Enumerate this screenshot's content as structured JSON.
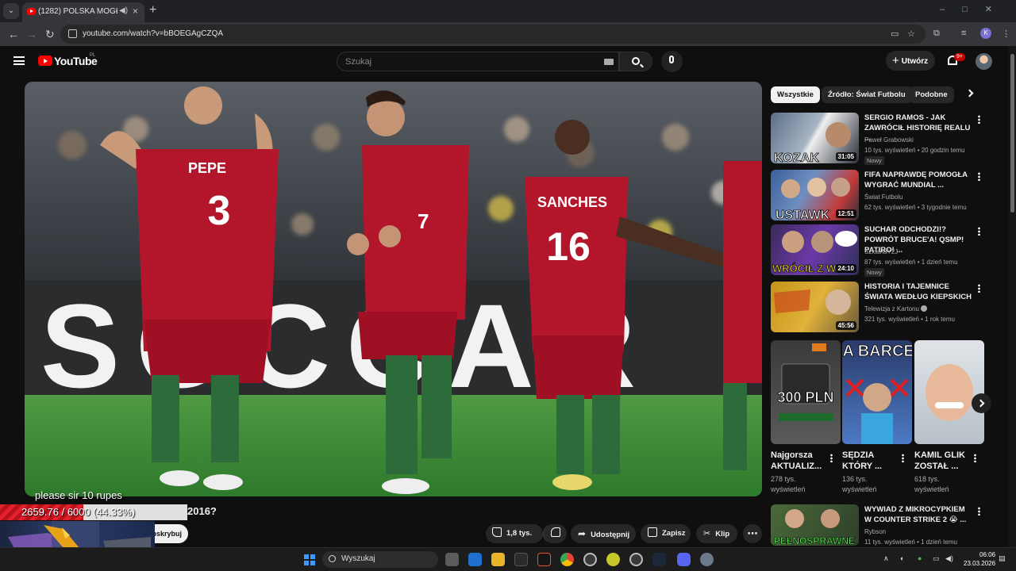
{
  "browser": {
    "tab_title": "(1282) POLSKA MOGŁA WY",
    "url": "youtube.com/watch?v=bBOEGAgCZQA",
    "profile_initial": "K"
  },
  "youtube": {
    "logo_text": "YouTube",
    "country_code": "PL",
    "search_placeholder": "Szukaj",
    "create_label": "Utwórz",
    "notifications_badge": "9+"
  },
  "video": {
    "title_fragment": "2016?",
    "subscribe_label": "Subskrybuj",
    "actions": {
      "likes": "1,8 tys.",
      "share": "Udostępnij",
      "save": "Zapisz",
      "clip": "Klip"
    },
    "scene_text": {
      "jersey_pepe_name": "PEPE",
      "jersey_pepe_number": "3",
      "jersey_ronaldo_number": "7",
      "jersey_sanches_name": "SANCHES",
      "jersey_sanches_number": "16",
      "board_text": "SOCCAR"
    }
  },
  "stream_overlay": {
    "message": "please sir 10 rupes",
    "goal_text": "2659.76 / 6000 (44.33%)",
    "goal_fraction": 0.4433
  },
  "sidebar": {
    "chips": [
      "Wszystkie",
      "Źródło: Świat Futbolu",
      "Podobne"
    ],
    "recommendations": [
      {
        "title": "SERGIO RAMOS - JAK ZAWRÓCIŁ HISTORIĘ REALU ...",
        "channel": "Paweł Grabowski",
        "meta": "10 tys. wyświetleń • 20 godzin temu",
        "duration": "31:05",
        "badge": "Nowy",
        "thumb_text": "KOZAK"
      },
      {
        "title": "FIFA NAPRAWDĘ POMOGŁA WYGRAĆ MUNDIAL ...",
        "channel": "Świat Futbolu",
        "meta": "62 tys. wyświetleń • 3 tygodnie temu",
        "duration": "12:51",
        "badge": "",
        "thumb_text": "USTAWK"
      },
      {
        "title": "SUCHAR ODCHODZI!? POWRÓT BRUCE'A! QSMP! PATIRO! ...",
        "channel": "SzklanaY2J",
        "meta": "87 tys. wyświetleń • 1 dzień temu",
        "duration": "24:10",
        "badge": "Nowy",
        "thumb_text": "WRÓCIŁ Z WA"
      },
      {
        "title": "HISTORIA I TAJEMNICE ŚWIATA WEDŁUG KIEPSKICH",
        "channel": "Telewizja z Kartonu",
        "meta": "321 tys. wyświetleń • 1 rok temu",
        "duration": "45:56",
        "badge": "",
        "thumb_text": ""
      }
    ],
    "shorts": [
      {
        "title": "Najgorsza AKTUALIZ...",
        "views": "278 tys. wyświetleń",
        "thumb_text": "300 PLN"
      },
      {
        "title": "SĘDZIA KTÓRY ...",
        "views": "136 tys. wyświetleń",
        "thumb_text": "KOCHA BARCELONE"
      },
      {
        "title": "KAMIL GLIK ZOSTAŁ ...",
        "views": "618 tys. wyświetleń",
        "thumb_text": ""
      }
    ],
    "last_recommendation": {
      "title": "WYWIAD Z MIKROCYPKIEM W COUNTER STRIKE 2 😭 ...",
      "channel": "Rybson",
      "meta": "11 tys. wyświetleń • 1 dzień temu",
      "thumb_text": "PEŁNOSPRAWNE"
    }
  },
  "taskbar": {
    "search_label": "Wyszukaj",
    "time": "06:06",
    "date": "23.03.2026"
  },
  "colors": {
    "youtube_red": "#ff0000",
    "portugal_red": "#b3152a",
    "pitch_green": "#3d8a3a"
  }
}
